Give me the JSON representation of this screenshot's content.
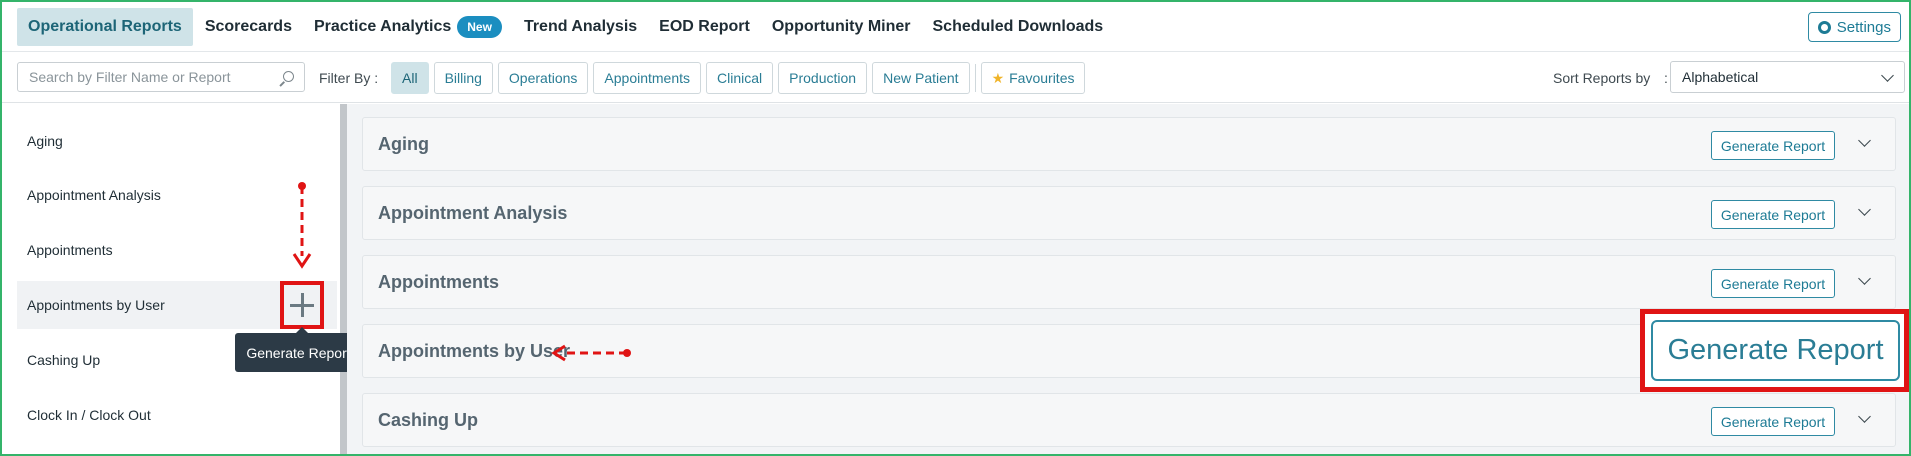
{
  "nav": {
    "tabs": [
      {
        "label": "Operational Reports"
      },
      {
        "label": "Scorecards"
      },
      {
        "label": "Practice Analytics",
        "badge": "New"
      },
      {
        "label": "Trend Analysis"
      },
      {
        "label": "EOD Report"
      },
      {
        "label": "Opportunity Miner"
      },
      {
        "label": "Scheduled Downloads"
      }
    ],
    "settings_label": "Settings"
  },
  "filters": {
    "search_placeholder": "Search by Filter Name or Report",
    "filter_by_label": "Filter By :",
    "chips": [
      "All",
      "Billing",
      "Operations",
      "Appointments",
      "Clinical",
      "Production",
      "New Patient"
    ],
    "favourites_label": "Favourites",
    "sort_label": "Sort Reports by",
    "sort_colon": ":",
    "sort_value": "Alphabetical"
  },
  "sidebar": {
    "items": [
      {
        "label": "Aging"
      },
      {
        "label": "Appointment Analysis"
      },
      {
        "label": "Appointments"
      },
      {
        "label": "Appointments by User"
      },
      {
        "label": "Cashing Up"
      },
      {
        "label": "Clock In / Clock Out"
      }
    ],
    "tooltip": "Generate Report"
  },
  "reports": [
    {
      "title": "Aging",
      "button": "Generate Report"
    },
    {
      "title": "Appointment Analysis",
      "button": "Generate Report"
    },
    {
      "title": "Appointments",
      "button": "Generate Report"
    },
    {
      "title": "Appointments by User",
      "button": "Generate Report"
    },
    {
      "title": "Cashing Up",
      "button": "Generate Report"
    }
  ],
  "callout_button": "Generate Report",
  "colors": {
    "accent": "#1d7b95",
    "active_tab_bg": "#cfe3e8",
    "badge": "#1b8ec0",
    "annotation": "#e01414",
    "frame": "#34b46a"
  }
}
